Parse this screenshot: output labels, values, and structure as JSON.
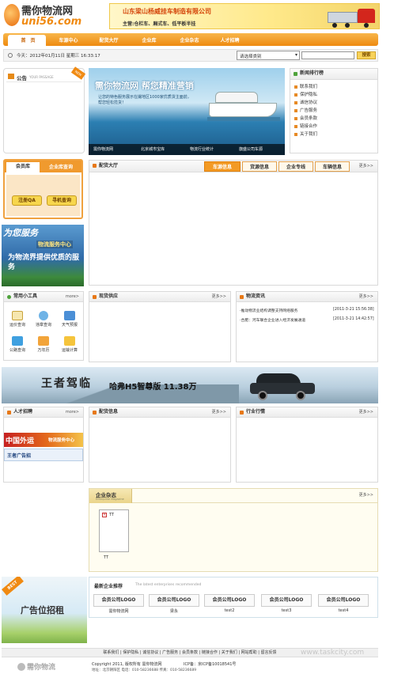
{
  "header": {
    "logo_cn": "需你物流网",
    "logo_en": "uni56.com",
    "company_name": "山东梁山杨威挂车制造有限公司",
    "company_products": "主营:仓栏车、厢式车、低平板半挂"
  },
  "nav": {
    "items": [
      "首　页",
      "车源中心",
      "配货大厅",
      "企业库",
      "企业杂志",
      "人才招聘"
    ]
  },
  "datebar": {
    "date_text": "今天：2012年01月11日 星期三 16:33:17",
    "select_value": "请选择类别",
    "search_button": "搜索"
  },
  "notice": {
    "title": "公告",
    "subtitle": "YOUR PASSAGE",
    "badge": "NEW"
  },
  "banner": {
    "title": "需你物流网 帮您精准营销",
    "subtitle": "让您的特色服务展示在撮地区1000家优质货主面前，帮您轻松揽货！",
    "caption": [
      "需你物流网",
      "北京城市宝库",
      "物流行业统计",
      "旗盛公司车源"
    ]
  },
  "ranking": {
    "title": "新闻排行榜",
    "items": [
      "联系我们",
      "保护隐私",
      "诚信协议",
      "广告服务",
      "会员条款",
      "链接合作",
      "关于我们"
    ]
  },
  "login": {
    "tabs": [
      "会员库",
      "企业库查询"
    ],
    "buttons": [
      "注册QA",
      "寻机查询"
    ]
  },
  "service_ad": {
    "line1": "为您服务",
    "line2": "物流服务中心",
    "line3": "为物流界提供优质的服务"
  },
  "cargo_hall": {
    "title": "配货大厅",
    "tabs": [
      "车源信息",
      "货源信息",
      "企业专线",
      "车辆信息"
    ],
    "more": "更多>>"
  },
  "tools": {
    "title": "常用小工具",
    "more": "more>",
    "items": [
      "运价查询",
      "违章查询",
      "天气预报",
      "公路查询",
      "万年历",
      "运输计算"
    ]
  },
  "trade": {
    "title": "现货供应",
    "more": "更多>>"
  },
  "news": {
    "title": "物流资讯",
    "more": "更多>>",
    "items": [
      {
        "text": "·推动物流业结构调整支持网络服务",
        "date": "[2011-3-21 15:56:38]"
      },
      {
        "text": "·合肥：河车联合企业进入经济发展通道",
        "date": "[2011-3-21 14:42:57]"
      }
    ]
  },
  "car_ad": {
    "slogan": "王者驾临",
    "model": "哈弗H5智尊版 11.38万"
  },
  "talent": {
    "title": "人才招聘",
    "more": "more>",
    "ad_text": "中国外运",
    "ad_sub": "物流服务中心",
    "link": "王者广告招"
  },
  "cargo_info": {
    "title": "配货信息",
    "more": "更多>>"
  },
  "industry": {
    "title": "行业行情",
    "more": "更多>>"
  },
  "magazine": {
    "title": "企业杂志",
    "subtitle": "Enterprise Magazine",
    "more": "更多>>",
    "item_alt": "TT",
    "item_name": "TT"
  },
  "ad_slot": {
    "badge": "BEST",
    "text": "广告位招租"
  },
  "recommended": {
    "title": "最新企业推荐",
    "subtitle": "The latest enterprises recommended",
    "items": [
      {
        "logo": "会员公司LOGO",
        "name": "需你物流网"
      },
      {
        "logo": "会员公司LOGO",
        "name": "梁永"
      },
      {
        "logo": "会员公司LOGO",
        "name": "test2"
      },
      {
        "logo": "会员公司LOGO",
        "name": "test3"
      },
      {
        "logo": "会员公司LOGO",
        "name": "test4"
      }
    ]
  },
  "footer": {
    "links": [
      "联系我们",
      "保护隐私",
      "诚信协议",
      "广告服务",
      "会员条款",
      "链接合作",
      "关于我们",
      "网站帮助",
      "留言反馈"
    ],
    "logo_text": "需你物流",
    "copyright": "Copyright 2011, 版权所有 需你物流网",
    "icp": "ICP备：京ICP备10018541号",
    "contact": "地址：北京朝阳区 电话：010-58236688 传真：010-58236689",
    "watermark": "www.taskcity.com"
  },
  "colors": {
    "brand_orange": "#f18a14",
    "nav_bg": "#f39c12"
  }
}
